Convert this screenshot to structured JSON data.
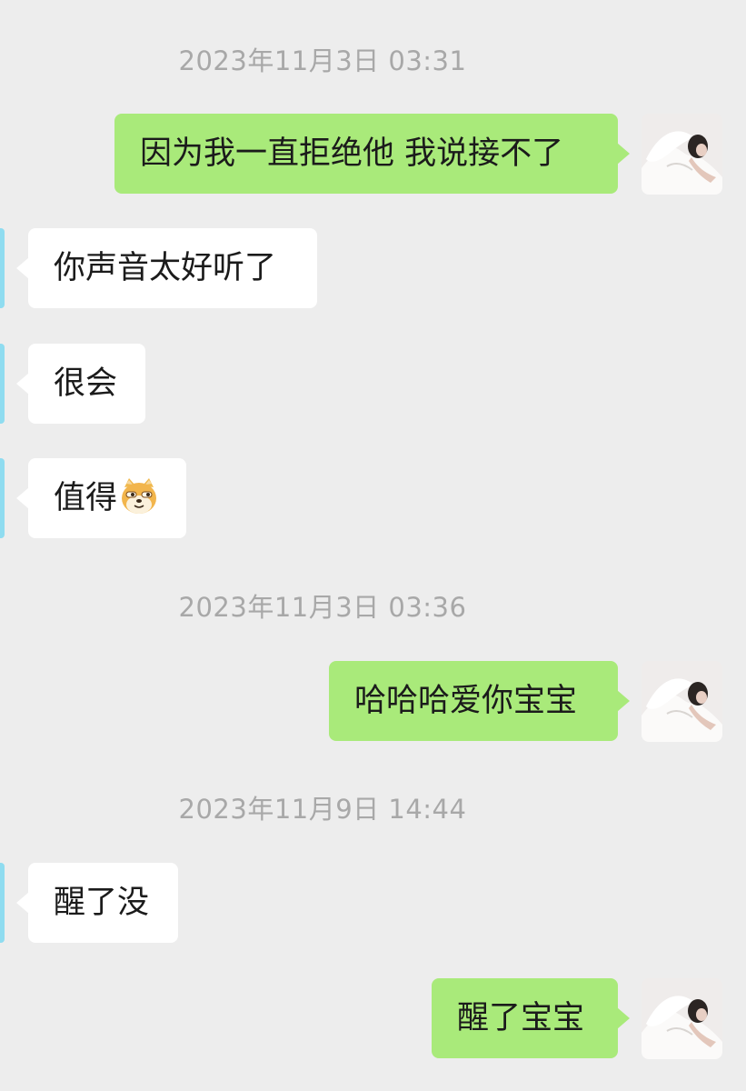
{
  "timestamps": [
    "2023年11月3日 03:31",
    "2023年11月3日 03:36",
    "2023年11月9日 14:44"
  ],
  "messages": [
    {
      "side": "right",
      "text": "因为我一直拒绝他 我说接不了"
    },
    {
      "side": "left",
      "text": "你声音太好听了"
    },
    {
      "side": "left",
      "text": "很会"
    },
    {
      "side": "left",
      "text": "值得",
      "emoji": "doge-emoji"
    },
    {
      "side": "right",
      "text": "哈哈哈爱你宝宝"
    },
    {
      "side": "left",
      "text": "醒了没"
    },
    {
      "side": "right",
      "text": "醒了宝宝"
    }
  ],
  "colors": {
    "background": "#ededed",
    "outgoing_bubble": "#a9ea7a",
    "incoming_bubble": "#ffffff",
    "timestamp_text": "#a8a8a8",
    "incoming_avatar_edge": "#8fdcf0"
  },
  "icons": {
    "outgoing_avatar": "user-photo-avatar",
    "incoming_avatar": "contact-avatar",
    "emoji": "doge-emoji"
  }
}
